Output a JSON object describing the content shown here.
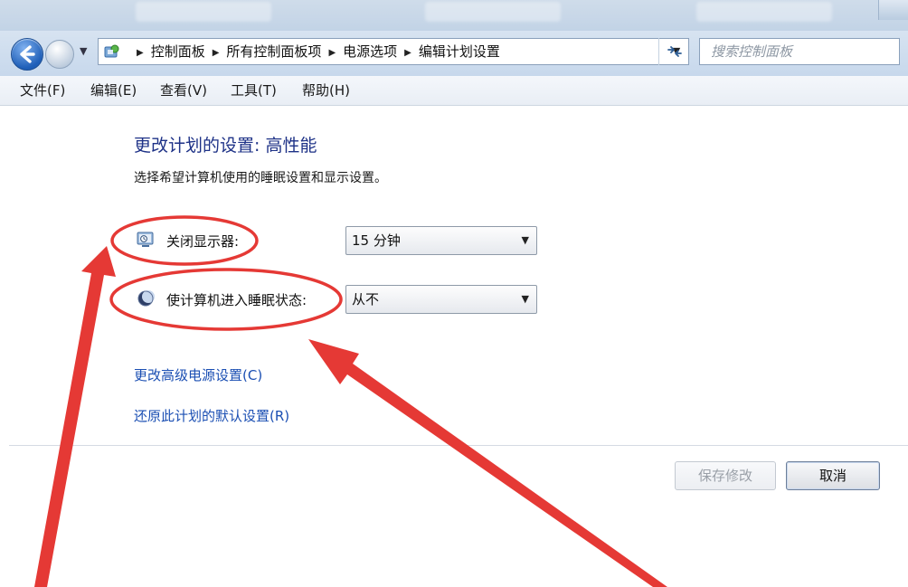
{
  "address_bar": {
    "breadcrumbs": [
      "控制面板",
      "所有控制面板项",
      "电源选项",
      "编辑计划设置"
    ],
    "search_placeholder": "搜索控制面板"
  },
  "menu": {
    "items": [
      "文件(F)",
      "编辑(E)",
      "查看(V)",
      "工具(T)",
      "帮助(H)"
    ]
  },
  "content": {
    "title": "更改计划的设置: 高性能",
    "subtitle": "选择希望计算机使用的睡眠设置和显示设置。",
    "settings": [
      {
        "label": "关闭显示器:",
        "value": "15 分钟",
        "icon": "monitor-clock-icon"
      },
      {
        "label": "使计算机进入睡眠状态:",
        "value": "从不",
        "icon": "moon-sleep-icon"
      }
    ],
    "links": [
      "更改高级电源设置(C)",
      "还原此计划的默认设置(R)"
    ]
  },
  "footer": {
    "save_label": "保存修改",
    "cancel_label": "取消"
  },
  "colors": {
    "heading": "#1e3287",
    "link": "#1b4fb3",
    "annotation": "#e53935"
  }
}
